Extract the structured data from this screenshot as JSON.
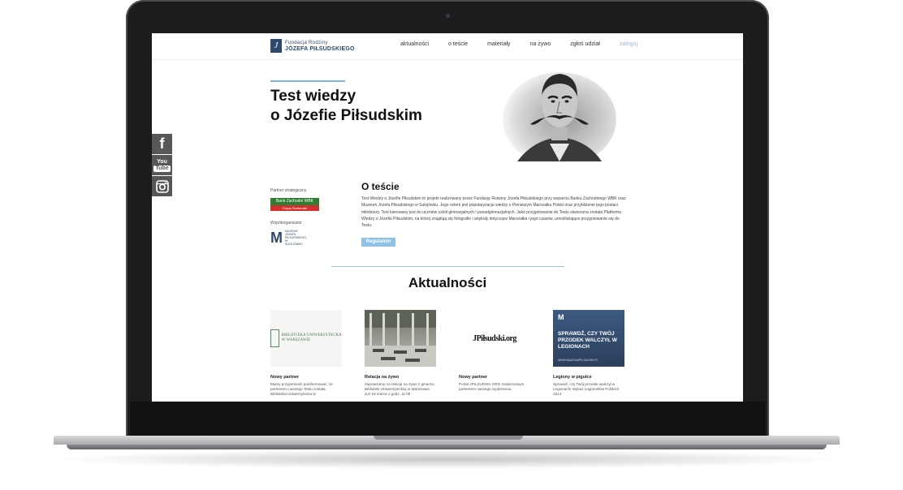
{
  "site": {
    "logo_line1": "Fundacja Rodziny",
    "logo_line2": "JÓZEFA PIŁSUDSKIEGO",
    "logo_mark": "J",
    "nav": [
      "aktualności",
      "o teście",
      "materiały",
      "na żywo",
      "zgłoś udział",
      "zaloguj"
    ],
    "social": {
      "facebook": "f",
      "youtube_top": "You",
      "youtube_bottom": "Tube"
    }
  },
  "hero": {
    "title_line1": "Test wiedzy",
    "title_line2": "o Józefie Piłsudskim"
  },
  "partners": {
    "strategic_label": "Partner strategiczny",
    "bank_name": "Bank Zachodni WBK",
    "bank_group": "Grupa Santander",
    "coorg_label": "Współorganizator",
    "coorg_name": "MUZEUM JÓZEFA PIŁSUDSKIEGO W SULEJÓWKU"
  },
  "about": {
    "title": "O teście",
    "text": "Test Wiedzy o Józefie Piłsudskim to projekt realizowany przez Fundację Rodziny Józefa Piłsudskiego przy wsparciu Banku Zachodniego WBK oraz Muzeum Józefa Piłsudskiego w Sulejówku. Jego celem jest popularyzacja wiedzy o Pierwszym Marszałku Polski oraz przybliżenie jego postaci młodzieży. Test kierowany jest do uczniów szkół gimnazjalnych i ponadgimnazjalnych. Jako przygotowanie do Testu stworzona została Platforma Wiedzy o Józefie Piłsudskim, na której znajdują się fotografie i artykuły dotyczące Marszałka i jego czasów, umożliwiające przygotowanie się do Testu.",
    "button": "Regulamin"
  },
  "news": {
    "title": "Aktualności",
    "items": [
      {
        "caption": "Nowy partner",
        "text": "Mamy przyjemność poinformować, że partnerem naszego Testu została Biblioteka Uniwersytecka w",
        "img_text": "BIBLIOTEKA UNIWERSYTECKA W WARSZAWIE"
      },
      {
        "caption": "Relacja na żywo",
        "text": "Zapraszamy na relację na żywo z gmachu Biblioteki Uniwersyteckiej w Warszawie. Już 18 marca o godz. 11:00"
      },
      {
        "caption": "Nowy partner",
        "text": "Portal JPILSUDSKI.ORG został nowym partnerem naszego wydarzenia.",
        "img_text": "JPiłsudski.org"
      },
      {
        "caption": "Legiony w pigułce",
        "text": "Sprawdź, czy Twój przodek walczył w Legionach! Wykaz Legionistów Polskich 1914-",
        "img_text": "SPRAWDŹ, CZY TWÓJ PRZODEK WALCZYŁ W LEGIONACH",
        "img_foot": "WWW.MUZEUMPILSUDSKI.PL"
      }
    ]
  },
  "colors": {
    "accent": "#7fb6e0",
    "button": "#8fc0e6",
    "social_bg": "#555759",
    "bank_green": "#2e7d32",
    "bank_red": "#d32f2f"
  }
}
